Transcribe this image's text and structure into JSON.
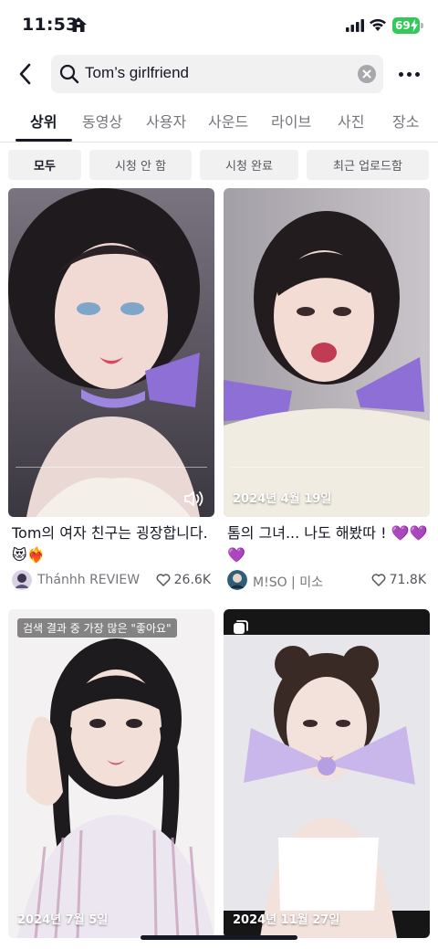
{
  "status": {
    "time": "11:53",
    "battery": "69"
  },
  "search": {
    "query": "Tom’s girlfriend"
  },
  "tabs": [
    "상위",
    "동영상",
    "사용자",
    "사운드",
    "라이브",
    "사진",
    "장소"
  ],
  "filters": [
    "모두",
    "시청 안 함",
    "시청 완료",
    "최근 업로드함"
  ],
  "videos": [
    {
      "caption": "Tom의 여자 친구는 굉장합니다.😻❤️‍🔥",
      "author": "Thánhh REVIEW",
      "likes": "26.6K",
      "date": ""
    },
    {
      "caption": "톰의 그녀... 나도 해봤따 ! 💜💜💜",
      "author": "M!SO | 미소",
      "likes": "71.8K",
      "date": "2024년 4월 19일"
    },
    {
      "badge": "검색 결과 중 가장 많은 \"좋아요\"",
      "date": "2024년 7월 5일"
    },
    {
      "date": "2024년 11월 27일"
    }
  ],
  "colors": {
    "accent": "#161823",
    "battery": "#34c759",
    "bow": "#8e6fd6"
  }
}
